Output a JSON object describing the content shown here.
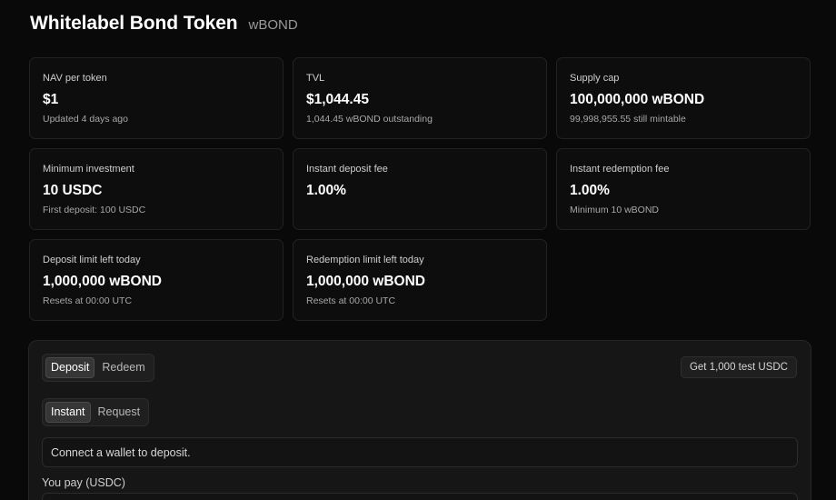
{
  "header": {
    "title": "Whitelabel Bond Token",
    "symbol": "wBOND"
  },
  "cards": [
    {
      "label": "NAV per token",
      "value": "$1",
      "sub": "Updated 4 days ago"
    },
    {
      "label": "TVL",
      "value": "$1,044.45",
      "sub": "1,044.45 wBOND outstanding"
    },
    {
      "label": "Supply cap",
      "value": "100,000,000 wBOND",
      "sub": "99,998,955.55 still mintable"
    },
    {
      "label": "Minimum investment",
      "value": "10 USDC",
      "sub": "First deposit: 100 USDC"
    },
    {
      "label": "Instant deposit fee",
      "value": "1.00%",
      "sub": ""
    },
    {
      "label": "Instant redemption fee",
      "value": "1.00%",
      "sub": "Minimum 10 wBOND"
    },
    {
      "label": "Deposit limit left today",
      "value": "1,000,000 wBOND",
      "sub": "Resets at 00:00 UTC"
    },
    {
      "label": "Redemption limit left today",
      "value": "1,000,000 wBOND",
      "sub": "Resets at 00:00 UTC"
    }
  ],
  "panel": {
    "mode_tabs": [
      "Deposit",
      "Redeem"
    ],
    "mode_active": "Deposit",
    "type_tabs": [
      "Instant",
      "Request"
    ],
    "type_active": "Instant",
    "test_button": "Get 1,000 test USDC",
    "notice": "Connect a wallet to deposit.",
    "pay_label": "You pay (USDC)"
  }
}
